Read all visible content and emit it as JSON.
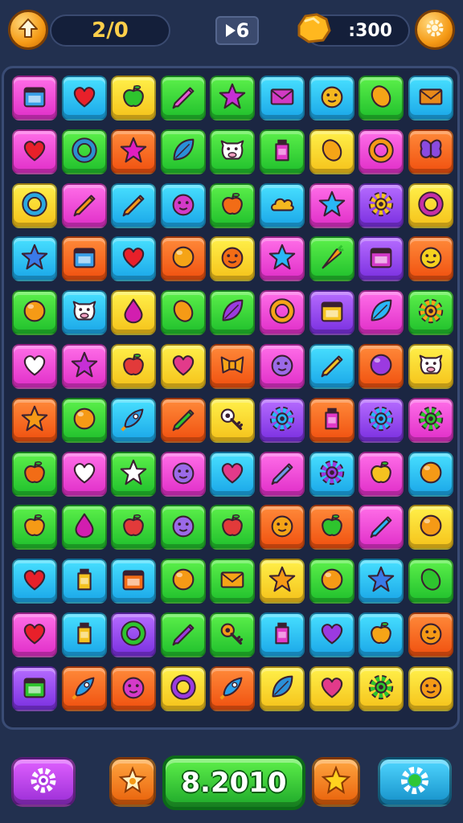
{
  "header": {
    "moves": "2/0",
    "level": "6",
    "coins": ":300",
    "home_icon": "arrow-up-icon",
    "coin_icon": "gold-nugget-icon",
    "settings_icon": "gear-icon"
  },
  "footer": {
    "score": "8.2010",
    "left_icon": "gear-icon",
    "booster1_icon": "star-badge-icon",
    "booster2_icon": "star-badge-icon",
    "right_icon": "gear-icon"
  },
  "colors": {
    "accent_orange": "#f59a16",
    "score_green": "#2ec737",
    "board_bg": "#1b2642",
    "page_bg": "#22304f"
  },
  "board": {
    "columns": 9,
    "rows": [
      [
        [
          "pink",
          "calendar",
          "#3aa0e8"
        ],
        [
          "cyan",
          "heart",
          "#e8202a"
        ],
        [
          "yellow",
          "apple",
          "#2ec42e"
        ],
        [
          "green",
          "pencil",
          "#e85ad8"
        ],
        [
          "green",
          "star",
          "#c62fd6"
        ],
        [
          "cyan",
          "envelope",
          "#d23ac4"
        ],
        [
          "cyan",
          "face",
          "#f5b81f"
        ],
        [
          "green",
          "lemon",
          "#f5a417"
        ],
        [
          "cyan",
          "envelope",
          "#e88a1a"
        ]
      ],
      [
        [
          "pink",
          "heart",
          "#e8202a"
        ],
        [
          "green",
          "ring",
          "#2b8fcf"
        ],
        [
          "orange",
          "star",
          "#e01ec0"
        ],
        [
          "green",
          "leaf",
          "#2a8fd8"
        ],
        [
          "green",
          "cow",
          "#ffffff"
        ],
        [
          "green",
          "bottle",
          "#e23ac8"
        ],
        [
          "yellow",
          "lemon",
          "#f5a417"
        ],
        [
          "pink",
          "ring",
          "#f59a16"
        ],
        [
          "orange",
          "butterfly",
          "#8a4ae0"
        ]
      ],
      [
        [
          "yellow",
          "ring",
          "#2aa8e0"
        ],
        [
          "pink",
          "pencil",
          "#f59a16"
        ],
        [
          "cyan",
          "pencil",
          "#f59a16"
        ],
        [
          "cyan",
          "face",
          "#d43ac8"
        ],
        [
          "green",
          "apple",
          "#f26c16"
        ],
        [
          "cyan",
          "cloud",
          "#f5b81f"
        ],
        [
          "pink",
          "star",
          "#29b6f6"
        ],
        [
          "purple",
          "gear",
          "#f5c21f"
        ],
        [
          "yellow",
          "ring",
          "#c62fa6"
        ]
      ],
      [
        [
          "cyan",
          "star",
          "#3a7ae8"
        ],
        [
          "orange",
          "calendar",
          "#3aa0e8"
        ],
        [
          "cyan",
          "heart",
          "#e8202a"
        ],
        [
          "orange",
          "ball",
          "#f5a417"
        ],
        [
          "yellow",
          "face",
          "#f26c16"
        ],
        [
          "pink",
          "star",
          "#29b6f6"
        ],
        [
          "green",
          "carrot",
          "#f59a16"
        ],
        [
          "purple",
          "calendar",
          "#d43ac8"
        ],
        [
          "orange",
          "face",
          "#f5d21f"
        ]
      ],
      [
        [
          "green",
          "ball",
          "#f59a16"
        ],
        [
          "cyan",
          "cow",
          "#ffffff"
        ],
        [
          "yellow",
          "drop",
          "#d21eaf"
        ],
        [
          "green",
          "lemon",
          "#f59a16"
        ],
        [
          "green",
          "leaf",
          "#9b3ae0"
        ],
        [
          "pink",
          "ring",
          "#f5a417"
        ],
        [
          "purple",
          "calendar",
          "#f5c21f"
        ],
        [
          "pink",
          "leaf",
          "#29b6f6"
        ],
        [
          "green",
          "gear",
          "#f5a417"
        ]
      ],
      [
        [
          "pink",
          "heart",
          "#ffffff"
        ],
        [
          "pink",
          "star",
          "#c62fd6"
        ],
        [
          "yellow",
          "apple",
          "#e23a3a"
        ],
        [
          "yellow",
          "heart",
          "#e23a8a"
        ],
        [
          "orange",
          "bow",
          "#f5a417"
        ],
        [
          "pink",
          "face",
          "#9b6ae8"
        ],
        [
          "cyan",
          "pencil",
          "#f5c21f"
        ],
        [
          "orange",
          "ball",
          "#9b3ae0"
        ],
        [
          "yellow",
          "cow",
          "#ffffff"
        ]
      ],
      [
        [
          "orange",
          "star",
          "#f59a16"
        ],
        [
          "green",
          "ball",
          "#f59a16"
        ],
        [
          "cyan",
          "rocket",
          "#29a0e8"
        ],
        [
          "orange",
          "pencil",
          "#2ec42e"
        ],
        [
          "yellow",
          "key",
          "#ffffff"
        ],
        [
          "purple",
          "gear",
          "#29b6f6"
        ],
        [
          "orange",
          "bottle",
          "#e23ac8"
        ],
        [
          "purple",
          "gear",
          "#29b6f6"
        ],
        [
          "pink",
          "gear",
          "#2ec42e"
        ]
      ],
      [
        [
          "green",
          "apple",
          "#f26c16"
        ],
        [
          "pink",
          "heart",
          "#ffffff"
        ],
        [
          "green",
          "star",
          "#ffffff"
        ],
        [
          "pink",
          "face",
          "#9b6ae8"
        ],
        [
          "cyan",
          "heart",
          "#e23a8a"
        ],
        [
          "pink",
          "pencil",
          "#6a9ae8"
        ],
        [
          "cyan",
          "gear",
          "#9b3ae0"
        ],
        [
          "pink",
          "apple",
          "#f5c21f"
        ],
        [
          "cyan",
          "ball",
          "#f59a16"
        ]
      ],
      [
        [
          "green",
          "apple",
          "#f59a16"
        ],
        [
          "green",
          "drop",
          "#d21eaf"
        ],
        [
          "green",
          "apple",
          "#e23a3a"
        ],
        [
          "green",
          "face",
          "#9b6ae8"
        ],
        [
          "green",
          "apple",
          "#e23a3a"
        ],
        [
          "orange",
          "face",
          "#f5a417"
        ],
        [
          "orange",
          "apple",
          "#2ec42e"
        ],
        [
          "pink",
          "pencil",
          "#29b6f6"
        ],
        [
          "yellow",
          "ball",
          "#f59a16"
        ]
      ],
      [
        [
          "cyan",
          "heart",
          "#e8202a"
        ],
        [
          "cyan",
          "bottle",
          "#f5c21f"
        ],
        [
          "cyan",
          "calendar",
          "#f26c16"
        ],
        [
          "green",
          "ball",
          "#f59a16"
        ],
        [
          "green",
          "envelope",
          "#f5a417"
        ],
        [
          "yellow",
          "star",
          "#f59a16"
        ],
        [
          "green",
          "ball",
          "#f59a16"
        ],
        [
          "cyan",
          "star",
          "#3a7ae8"
        ],
        [
          "green",
          "lemon",
          "#2ec42e"
        ]
      ],
      [
        [
          "pink",
          "heart",
          "#e8202a"
        ],
        [
          "cyan",
          "bottle",
          "#f5c21f"
        ],
        [
          "purple",
          "ring",
          "#2ec42e"
        ],
        [
          "green",
          "pencil",
          "#9b3ae0"
        ],
        [
          "green",
          "key",
          "#f59a16"
        ],
        [
          "cyan",
          "bottle",
          "#e23ac8"
        ],
        [
          "cyan",
          "heart",
          "#9b3ae0"
        ],
        [
          "cyan",
          "apple",
          "#f5a417"
        ],
        [
          "orange",
          "face",
          "#f59a16"
        ]
      ],
      [
        [
          "purple",
          "calendar",
          "#2ec42e"
        ],
        [
          "orange",
          "rocket",
          "#29a0e8"
        ],
        [
          "orange",
          "face",
          "#d43ac8"
        ],
        [
          "yellow",
          "ring",
          "#9b3ae0"
        ],
        [
          "orange",
          "rocket",
          "#29a0e8"
        ],
        [
          "yellow",
          "leaf",
          "#2a8fd8"
        ],
        [
          "yellow",
          "heart",
          "#e23a8a"
        ],
        [
          "yellow",
          "gear",
          "#2ec42e"
        ],
        [
          "yellow",
          "face",
          "#f59a16"
        ]
      ]
    ]
  }
}
